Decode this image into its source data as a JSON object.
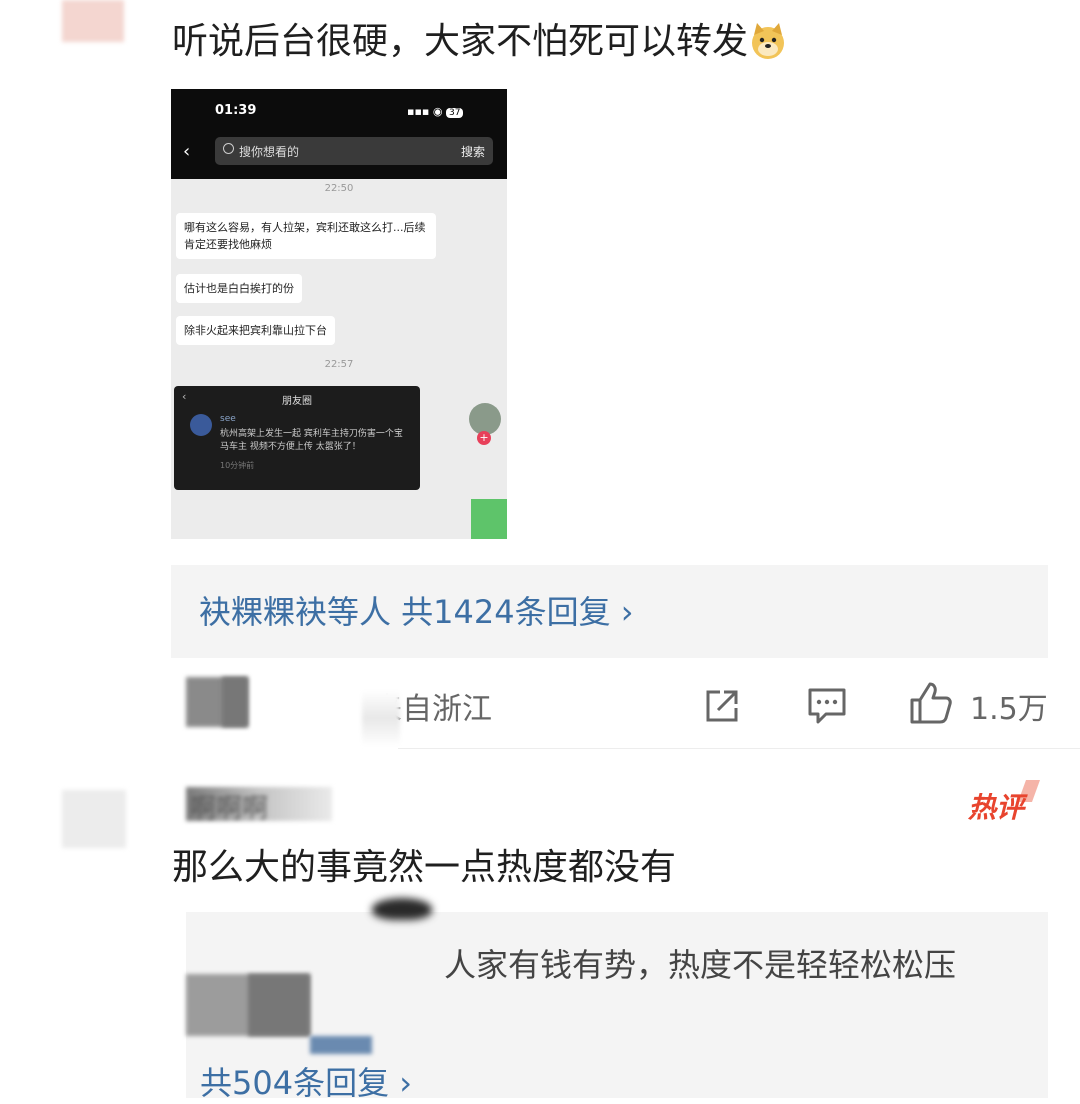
{
  "comment1": {
    "text": "听说后台很硬，大家不怕死可以转发",
    "emoji": "doge-icon",
    "screenshot": {
      "status_time": "01:39",
      "battery": "37",
      "search_placeholder": "搜你想看的",
      "search_button": "搜索",
      "chat_time_1": "22:50",
      "messages": [
        "哪有这么容易，有人拉架，宾利还敢这么打...后续肯定还要找他麻烦",
        "估计也是白白挨打的份",
        "除非火起来把宾利靠山拉下台"
      ],
      "chat_time_2": "22:57",
      "moment": {
        "title": "朋友圈",
        "user": "see",
        "text": "杭州高架上发生一起 宾利车主持刀伤害一个宝马车主 视频不方便上传 太嚣张了！",
        "meta": "10分钟前"
      },
      "side_badge": "+"
    },
    "replies_label": "袂粿粿袂等人  共1424条回复",
    "location": "来自浙江",
    "likes": "1.5万"
  },
  "comment2": {
    "username": "啊啊啊",
    "badge": "热评",
    "text": "那么大的事竟然一点热度都没有",
    "reply_preview": "人家有钱有势，热度不是轻轻松松压",
    "replies_label": "共504条回复"
  },
  "colors": {
    "link": "#3d6fa4",
    "hot": "#e8442e",
    "box": "#f4f4f4"
  }
}
